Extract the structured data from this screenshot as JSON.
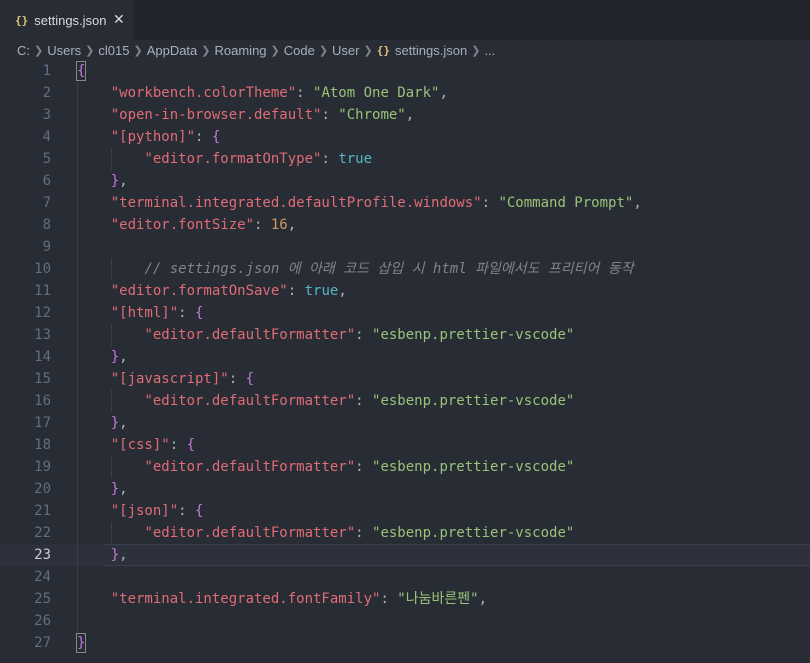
{
  "tab": {
    "icon": "{}",
    "label": "settings.json",
    "close_glyph": "✕"
  },
  "breadcrumb": {
    "segments": [
      "C:",
      "Users",
      "cl015",
      "AppData",
      "Roaming",
      "Code",
      "User"
    ],
    "file_icon": "{}",
    "file": "settings.json",
    "tail": "..."
  },
  "editor": {
    "current_line": 23,
    "lines": [
      [
        [
          "brace",
          "{"
        ]
      ],
      [
        [
          "sp",
          "    "
        ],
        [
          "key",
          "\"workbench.colorTheme\""
        ],
        [
          "punc",
          ": "
        ],
        [
          "str",
          "\"Atom One Dark\""
        ],
        [
          "punc",
          ","
        ]
      ],
      [
        [
          "sp",
          "    "
        ],
        [
          "key",
          "\"open-in-browser.default\""
        ],
        [
          "punc",
          ": "
        ],
        [
          "str",
          "\"Chrome\""
        ],
        [
          "punc",
          ","
        ]
      ],
      [
        [
          "sp",
          "    "
        ],
        [
          "key",
          "\"[python]\""
        ],
        [
          "punc",
          ": "
        ],
        [
          "brack",
          "{"
        ]
      ],
      [
        [
          "sp",
          "        "
        ],
        [
          "key",
          "\"editor.formatOnType\""
        ],
        [
          "punc",
          ": "
        ],
        [
          "kw",
          "true"
        ]
      ],
      [
        [
          "sp",
          "    "
        ],
        [
          "brack",
          "}"
        ],
        [
          "punc",
          ","
        ]
      ],
      [
        [
          "sp",
          "    "
        ],
        [
          "key",
          "\"terminal.integrated.defaultProfile.windows\""
        ],
        [
          "punc",
          ": "
        ],
        [
          "str",
          "\"Command Prompt\""
        ],
        [
          "punc",
          ","
        ]
      ],
      [
        [
          "sp",
          "    "
        ],
        [
          "key",
          "\"editor.fontSize\""
        ],
        [
          "punc",
          ": "
        ],
        [
          "num",
          "16"
        ],
        [
          "punc",
          ","
        ]
      ],
      [],
      [
        [
          "sp",
          "        "
        ],
        [
          "comment",
          "// settings.json 에 아래 코드 삽입 시 html 파일에서도 프리티어 동작"
        ]
      ],
      [
        [
          "sp",
          "    "
        ],
        [
          "key",
          "\"editor.formatOnSave\""
        ],
        [
          "punc",
          ": "
        ],
        [
          "kw",
          "true"
        ],
        [
          "punc",
          ","
        ]
      ],
      [
        [
          "sp",
          "    "
        ],
        [
          "key",
          "\"[html]\""
        ],
        [
          "punc",
          ": "
        ],
        [
          "brack",
          "{"
        ]
      ],
      [
        [
          "sp",
          "        "
        ],
        [
          "key",
          "\"editor.defaultFormatter\""
        ],
        [
          "punc",
          ": "
        ],
        [
          "str",
          "\"esbenp.prettier-vscode\""
        ]
      ],
      [
        [
          "sp",
          "    "
        ],
        [
          "brack",
          "}"
        ],
        [
          "punc",
          ","
        ]
      ],
      [
        [
          "sp",
          "    "
        ],
        [
          "key",
          "\"[javascript]\""
        ],
        [
          "punc",
          ": "
        ],
        [
          "brack",
          "{"
        ]
      ],
      [
        [
          "sp",
          "        "
        ],
        [
          "key",
          "\"editor.defaultFormatter\""
        ],
        [
          "punc",
          ": "
        ],
        [
          "str",
          "\"esbenp.prettier-vscode\""
        ]
      ],
      [
        [
          "sp",
          "    "
        ],
        [
          "brack",
          "}"
        ],
        [
          "punc",
          ","
        ]
      ],
      [
        [
          "sp",
          "    "
        ],
        [
          "key",
          "\"[css]\""
        ],
        [
          "punc",
          ": "
        ],
        [
          "brack",
          "{"
        ]
      ],
      [
        [
          "sp",
          "        "
        ],
        [
          "key",
          "\"editor.defaultFormatter\""
        ],
        [
          "punc",
          ": "
        ],
        [
          "str",
          "\"esbenp.prettier-vscode\""
        ]
      ],
      [
        [
          "sp",
          "    "
        ],
        [
          "brack",
          "}"
        ],
        [
          "punc",
          ","
        ]
      ],
      [
        [
          "sp",
          "    "
        ],
        [
          "key",
          "\"[json]\""
        ],
        [
          "punc",
          ": "
        ],
        [
          "brack",
          "{"
        ]
      ],
      [
        [
          "sp",
          "        "
        ],
        [
          "key",
          "\"editor.defaultFormatter\""
        ],
        [
          "punc",
          ": "
        ],
        [
          "str",
          "\"esbenp.prettier-vscode\""
        ]
      ],
      [
        [
          "sp",
          "    "
        ],
        [
          "brack",
          "}"
        ],
        [
          "punc",
          ","
        ]
      ],
      [],
      [
        [
          "sp",
          "    "
        ],
        [
          "key",
          "\"terminal.integrated.fontFamily\""
        ],
        [
          "punc",
          ": "
        ],
        [
          "str",
          "\"나눔바른펜\""
        ],
        [
          "punc",
          ","
        ]
      ],
      [],
      [
        [
          "brace",
          "}"
        ]
      ]
    ]
  },
  "colors": {
    "background": "#282c34",
    "tabbar": "#21252b",
    "key": "#e06c75",
    "string": "#98c379",
    "number": "#d19a66",
    "boolean": "#56b6c2",
    "bracket": "#c678dd",
    "comment": "#7f848e"
  }
}
